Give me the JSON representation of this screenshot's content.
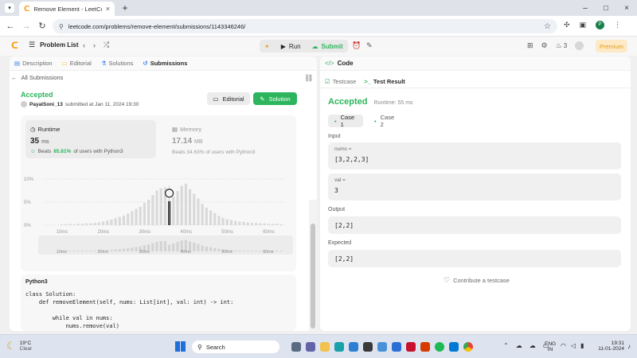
{
  "browser": {
    "tab_title": "Remove Element - LeetCode",
    "url": "leetcode.com/problems/remove-element/submissions/1143346246/"
  },
  "topbar": {
    "problem_list": "Problem List",
    "run": "Run",
    "submit": "Submit",
    "streak": "3",
    "premium": "Premium"
  },
  "left": {
    "tabs": [
      "Description",
      "Editorial",
      "Solutions",
      "Submissions"
    ],
    "all_submissions": "All Submissions",
    "status": "Accepted",
    "user": "PayalSoni_13",
    "submitted_text": "submitted at Jan 11, 2024 19:30",
    "editorial_btn": "Editorial",
    "solution_btn": "Solution",
    "runtime_label": "Runtime",
    "runtime_value": "35",
    "runtime_unit": "ms",
    "beats_prefix": "Beats",
    "beats_runtime": "85.81%",
    "beats_suffix": "of users with Python3",
    "memory_label": "Memory",
    "memory_value": "17.14",
    "memory_unit": "MB",
    "memory_beats": "Beats 34.63% of users with Python3",
    "language": "Python3",
    "code_lines": [
      "class Solution:",
      "    def removeElement(self, nums: List[int], val: int) -> int:",
      "",
      "        while val in nums:",
      "            nums.remove(val)"
    ]
  },
  "chart_data": {
    "type": "bar",
    "y_ticks": [
      "10%",
      "5%",
      "0%"
    ],
    "x_ticks": [
      "10ms",
      "20ms",
      "30ms",
      "40ms",
      "50ms",
      "60ms"
    ],
    "ylim": [
      0,
      10
    ],
    "xlim": [
      7,
      64
    ],
    "bar_x": [
      10,
      11,
      12,
      13,
      14,
      15,
      16,
      17,
      18,
      19,
      20,
      21,
      22,
      23,
      24,
      25,
      26,
      27,
      28,
      29,
      30,
      31,
      32,
      33,
      34,
      35,
      36,
      37,
      38,
      39,
      40,
      41,
      42,
      43,
      44,
      45,
      46,
      47,
      48,
      49,
      50,
      51,
      52,
      53,
      54,
      55,
      56,
      57,
      58,
      59,
      60,
      61,
      62,
      63
    ],
    "values": [
      0.2,
      0.2,
      0.3,
      0.2,
      0.3,
      0.3,
      0.4,
      0.4,
      0.5,
      0.6,
      0.8,
      1.0,
      1.2,
      1.5,
      1.8,
      2.1,
      2.5,
      3.0,
      3.5,
      4.0,
      4.8,
      5.5,
      6.5,
      7.5,
      8.0,
      8.2,
      5.2,
      6.2,
      7.4,
      8.5,
      9.0,
      7.8,
      6.8,
      5.8,
      4.6,
      3.8,
      3.2,
      2.6,
      2.0,
      1.6,
      1.3,
      1.1,
      0.9,
      0.8,
      0.7,
      0.6,
      0.5,
      0.5,
      0.4,
      0.4,
      0.3,
      0.3,
      0.3,
      0.2
    ],
    "highlight_x": 36,
    "highlight_value": 5.2,
    "highlight_color": "#262626",
    "bar_color": "#d9d9d9"
  },
  "right": {
    "code_tab": "Code",
    "testcase_tab": "Testcase",
    "result_tab": "Test Result",
    "status": "Accepted",
    "runtime": "Runtime: 55 ms",
    "cases": [
      "Case 1",
      "Case 2"
    ],
    "input_label": "Input",
    "nums_label": "nums =",
    "nums_value": "[3,2,2,3]",
    "val_label": "val =",
    "val_value": "3",
    "output_label": "Output",
    "output_value": "[2,2]",
    "expected_label": "Expected",
    "expected_value": "[2,2]",
    "contribute": "Contribute a testcase"
  },
  "taskbar": {
    "temp": "19°C",
    "weather": "Clear",
    "search": "Search",
    "lang1": "ENG",
    "lang2": "IN",
    "time": "19:31",
    "date": "11-01-2024"
  },
  "colors": {
    "accent_green": "#2db55d",
    "success_text": "#2db55d",
    "premium": "#e49b14"
  }
}
